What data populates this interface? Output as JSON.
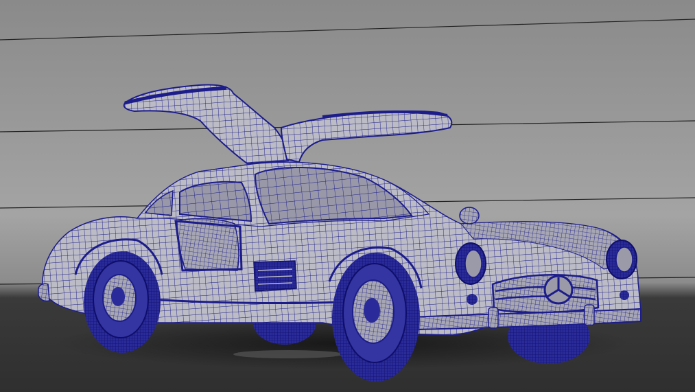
{
  "viewport": {
    "background_top": "#8f8f8f",
    "background_mid": "#a3a3a3",
    "floor_color": "#343434",
    "horizon_color": "#3c3c3c",
    "grid_line_color": "#222222"
  },
  "model": {
    "icon": "car-wireframe-icon",
    "wire_color": "#1c1c8a",
    "surface_color": "#b9b9c3",
    "surface_shade": "#9a9aa8",
    "glass_color": "#8c8c9c"
  }
}
